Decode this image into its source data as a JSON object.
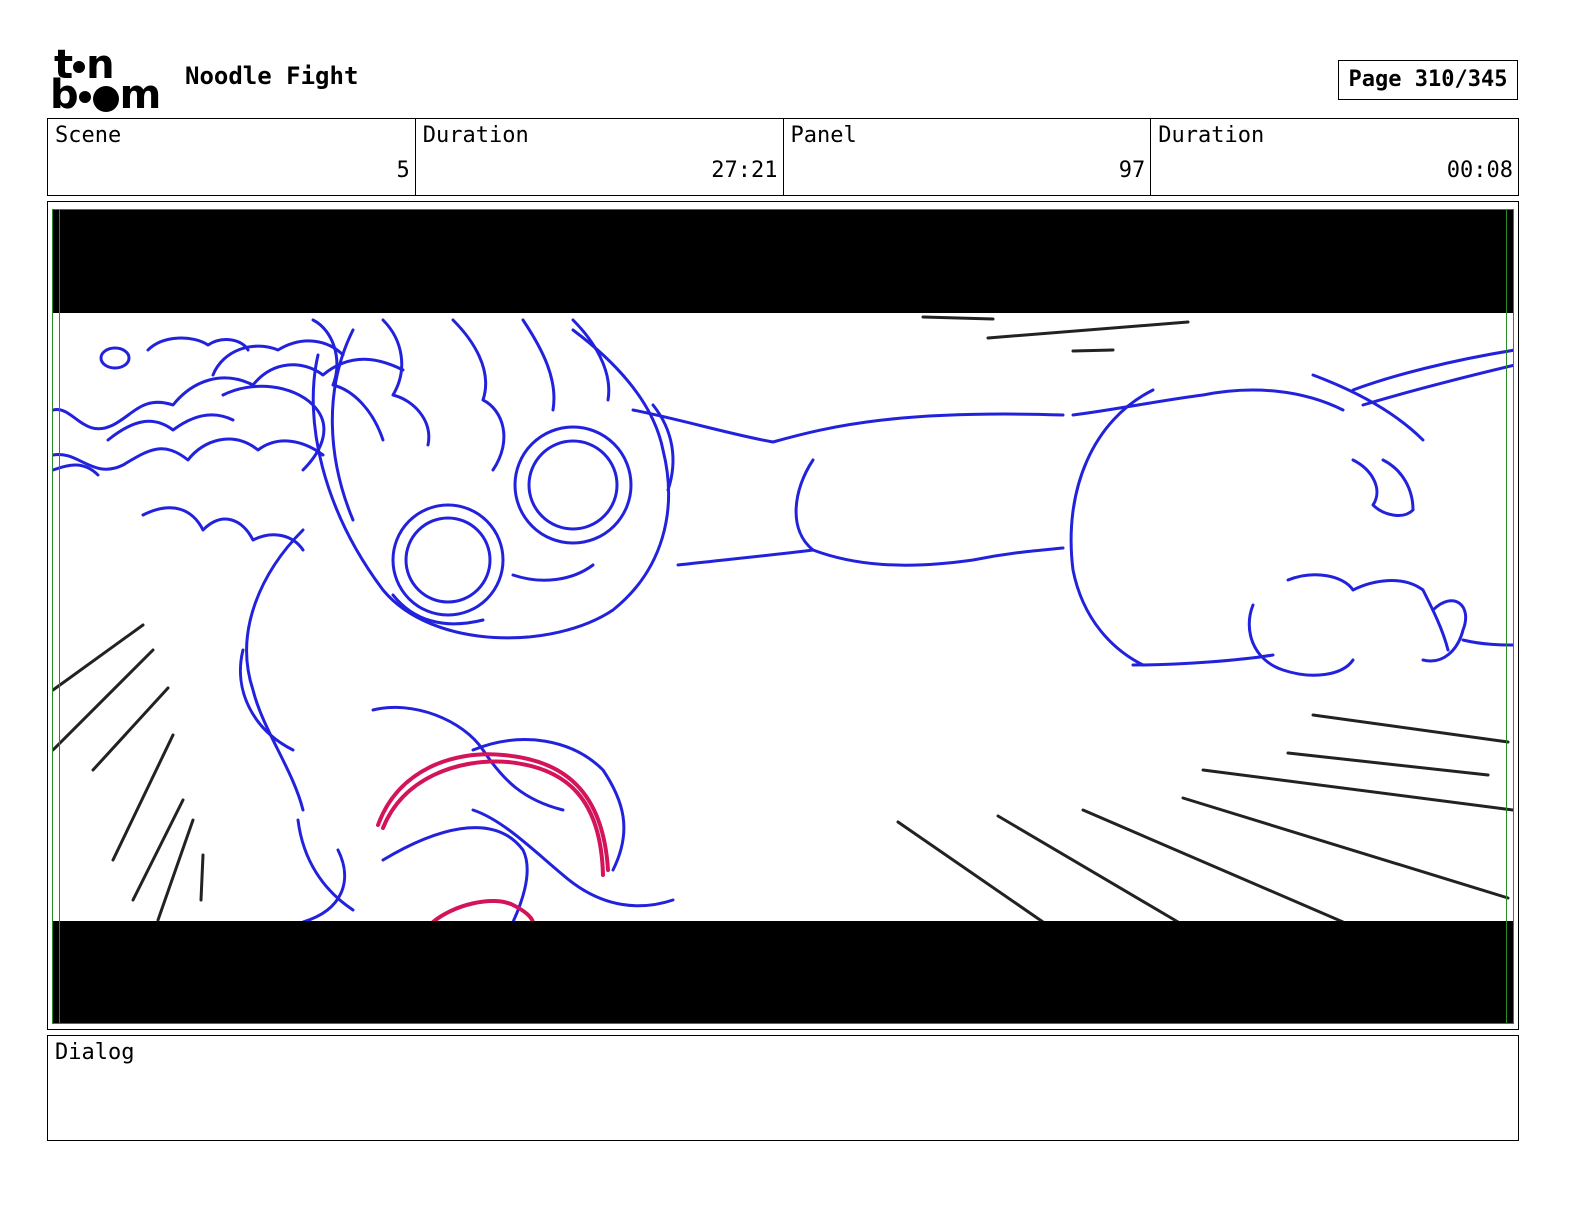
{
  "header": {
    "logo_text_line1": "toon",
    "logo_text_line2": "boom",
    "project_title": "Noodle Fight",
    "page_label": "Page 310/345"
  },
  "info_bar": {
    "scene_label": "Scene",
    "scene_value": "5",
    "duration_label": "Duration",
    "duration_value": "27:21",
    "panel_label": "Panel",
    "panel_value": "97",
    "panel_duration_label": "Duration",
    "panel_duration_value": "00:08"
  },
  "panel_image": {
    "description_icon": "storyboard-sketch",
    "colors": {
      "character_lines": "#2222dd",
      "accent_lines": "#d4145a",
      "speed_lines": "#222222",
      "letterbox": "#000000",
      "frame_guide": "#2a8a2a"
    }
  },
  "dialog": {
    "label": "Dialog",
    "text": ""
  }
}
